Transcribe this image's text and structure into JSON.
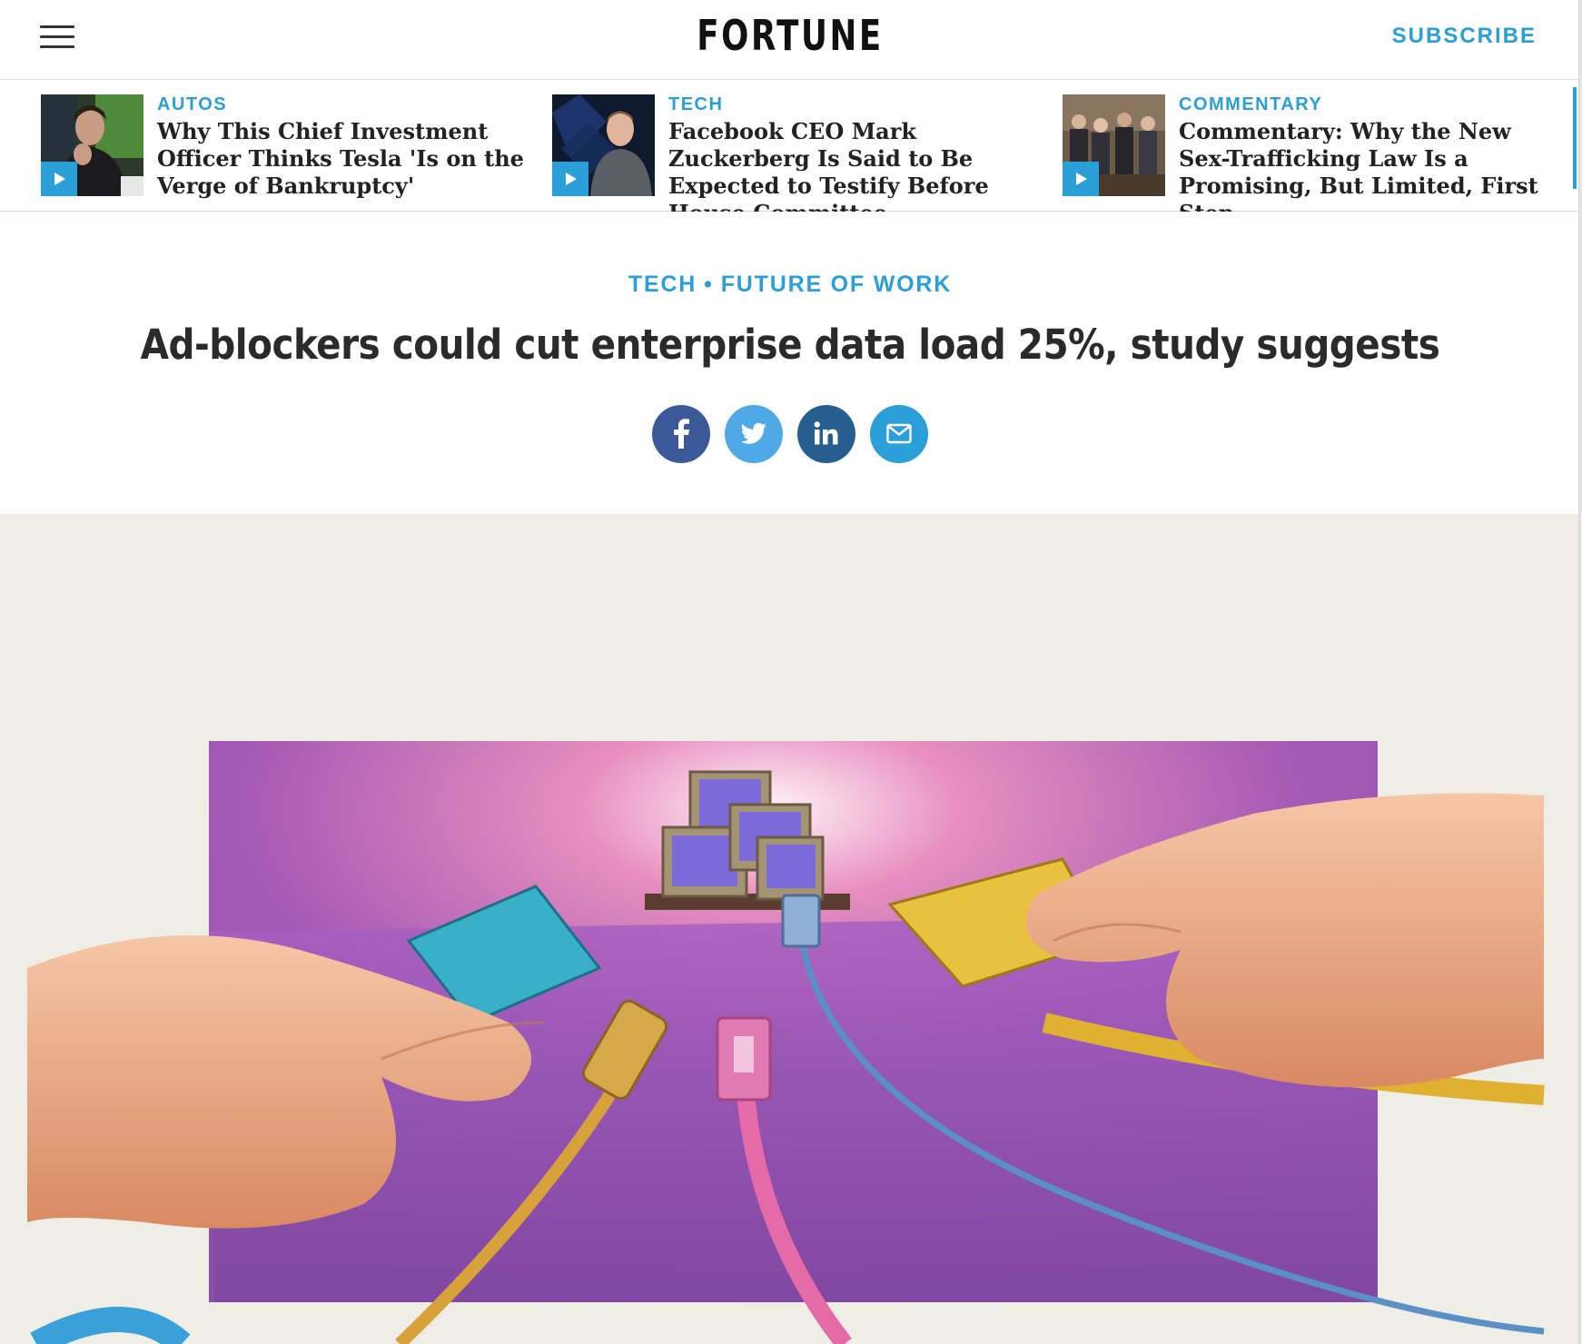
{
  "header": {
    "logo": "FORTUNE",
    "subscribe_label": "SUBSCRIBE"
  },
  "strip": {
    "items": [
      {
        "category": "AUTOS",
        "title": "Why This Chief Investment Officer Thinks Tesla 'Is on the Verge of Bankruptcy'"
      },
      {
        "category": "TECH",
        "title": "Facebook CEO Mark Zuckerberg Is Said to Be Expected to Testify Before House Committee"
      },
      {
        "category": "COMMENTARY",
        "title": "Commentary: Why the New Sex-Trafficking Law Is a Promising, But Limited, First Step"
      }
    ]
  },
  "article": {
    "kicker": {
      "section": "TECH",
      "subsection": "FUTURE OF WORK"
    },
    "headline": "Ad-blockers could cut enterprise data load 25%, study suggests"
  },
  "colors": {
    "accent": "#2a9fd8",
    "facebook": "#3b5998",
    "twitter": "#4fa9e7",
    "linkedin": "#265e8f",
    "email": "#2a9fd8"
  },
  "icons": {
    "menu": "hamburger-menu-icon",
    "share": [
      "facebook-icon",
      "twitter-icon",
      "linkedin-icon",
      "email-icon"
    ],
    "play": "play-icon"
  }
}
